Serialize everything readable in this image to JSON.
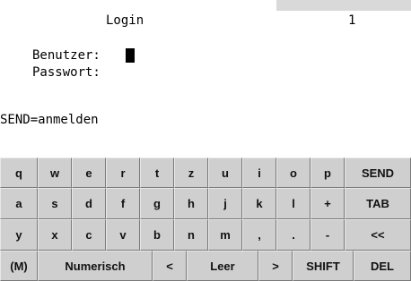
{
  "screen": {
    "title": "Login",
    "page_number": "1",
    "user_label": "Benutzer:",
    "password_label": "Passwort:",
    "hint": "SEND=anmelden"
  },
  "keyboard": {
    "row1": [
      "q",
      "w",
      "e",
      "r",
      "t",
      "z",
      "u",
      "i",
      "o",
      "p",
      "SEND"
    ],
    "row2": [
      "a",
      "s",
      "d",
      "f",
      "g",
      "h",
      "j",
      "k",
      "l",
      "+",
      "TAB"
    ],
    "row3": [
      "y",
      "x",
      "c",
      "v",
      "b",
      "n",
      "m",
      ",",
      ".",
      "-",
      "<<"
    ],
    "row4": [
      "(M)",
      "Numerisch",
      "<",
      "Leer",
      ">",
      "SHIFT",
      "DEL"
    ]
  }
}
